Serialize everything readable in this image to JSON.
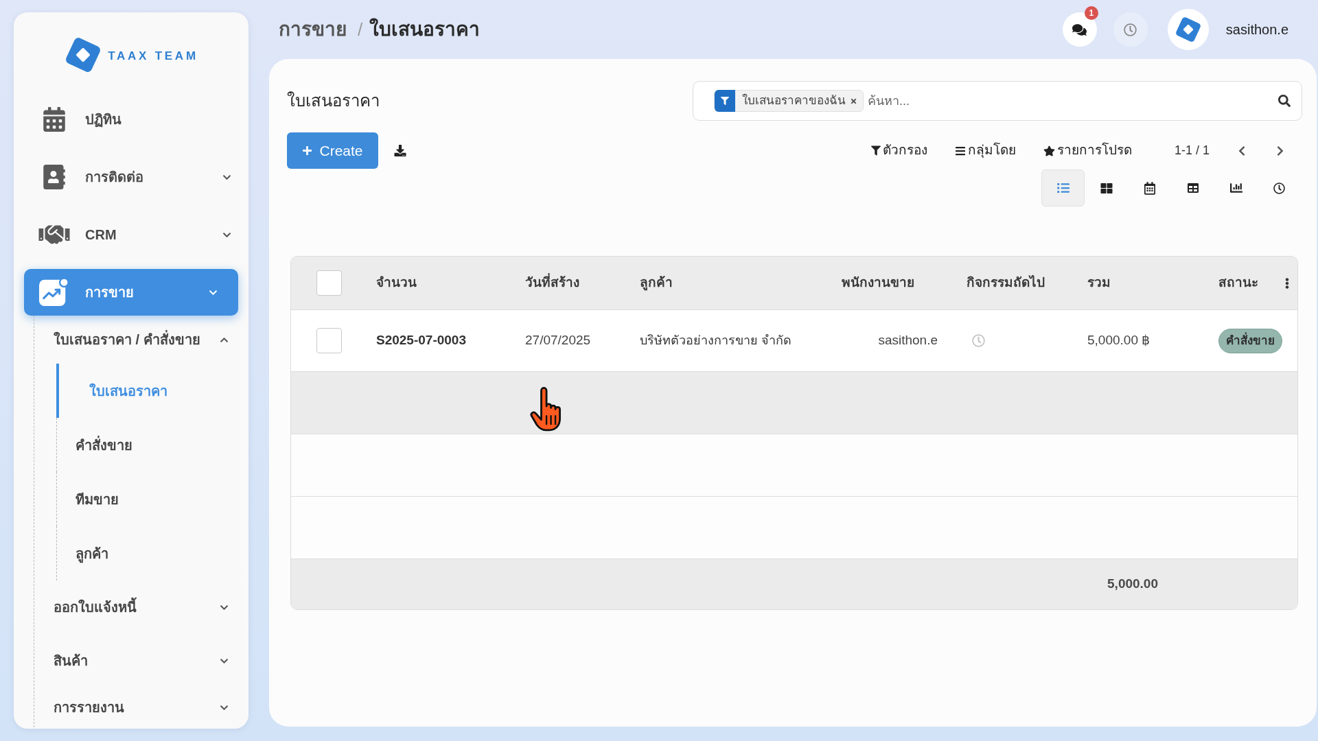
{
  "sidebar": {
    "logo": {
      "text": "TAAX TEAM"
    },
    "items": [
      {
        "label": "ปฏิทิน",
        "selected": false
      },
      {
        "label": "การติดต่อ",
        "selected": false,
        "expanded": false
      },
      {
        "label": "CRM",
        "selected": false,
        "expanded": false
      },
      {
        "label": "การขาย",
        "selected": true,
        "expanded": false,
        "children": [
          {
            "label": "ใบเสนอราคา / คำสั่งขาย",
            "selected": false,
            "expanded": true,
            "children": [
              {
                "label": "ใบเสนอราคา",
                "selected": true
              },
              {
                "label": "คำสั่งขาย",
                "selected": false
              },
              {
                "label": "ทีมขาย",
                "selected": false
              },
              {
                "label": "ลูกค้า",
                "selected": false
              }
            ]
          },
          {
            "label": "ออกใบแจ้งหนี้",
            "selected": false,
            "expanded": false
          },
          {
            "label": "สินค้า",
            "selected": false,
            "expanded": false
          },
          {
            "label": "การรายงาน",
            "selected": false,
            "expanded": false
          }
        ]
      }
    ]
  },
  "header": {
    "breadcrumb": {
      "items": [
        "การขาย",
        "ใบเสนอราคา"
      ],
      "separator": "/"
    },
    "messages": {
      "badge": "1"
    },
    "user": {
      "name": "sasithon.e"
    }
  },
  "panel": {
    "title": "ใบเสนอราคา",
    "search": {
      "facets": [
        {
          "label": "ใบเสนอราคาของฉัน"
        }
      ],
      "placeholder": "ค้นหา..."
    },
    "create_button": {
      "label": "Create"
    },
    "toolbar": {
      "menus": [
        {
          "label": "ตัวกรอง"
        },
        {
          "label": "กลุ่มโดย"
        },
        {
          "label": "รายการโปรด"
        }
      ],
      "pager": "1-1 / 1",
      "views": [
        {
          "selected": true
        },
        {
          "selected": false
        },
        {
          "selected": false
        },
        {
          "selected": false
        },
        {
          "selected": false
        },
        {
          "selected": false
        }
      ]
    }
  },
  "table": {
    "select_all": {
      "checked": false
    },
    "columns": [
      "จำนวน",
      "วันที่สร้าง",
      "ลูกค้า",
      "พนักงานขาย",
      "กิจกรรมถัดไป",
      "รวม",
      "สถานะ"
    ],
    "rows": [
      {
        "checked": false,
        "number": "S2025-07-0003",
        "date": "27/07/2025",
        "customer": "บริษัทตัวอย่างการขาย จำกัด",
        "salesperson": "sasithon.e",
        "total": "5,000.00 ฿",
        "status": "คำสั่งขาย"
      }
    ],
    "blank_rows": [
      {
        "highlighted": true
      },
      {
        "highlighted": false
      },
      {
        "highlighted": false
      }
    ],
    "footer_total": "5,000.00"
  }
}
